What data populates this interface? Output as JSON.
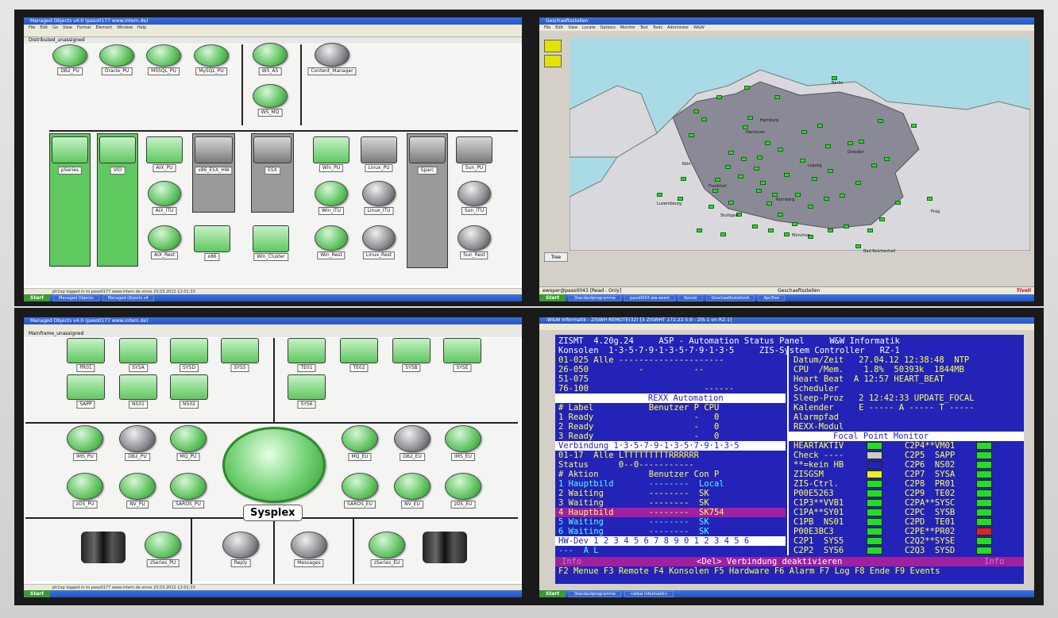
{
  "tl": {
    "title": "Managed Objects v4.0 (paso0177 www.intern.de)",
    "menu": [
      "File",
      "Edit",
      "Go",
      "View",
      "Format",
      "Element",
      "Window",
      "Help"
    ],
    "view_title": "Distributed_unassigned",
    "top_nodes": [
      "DB2_PU",
      "Oracle_PU",
      "MSSQL_PU",
      "MySQL_PU",
      "WS_AS",
      "WS_MQ",
      "Content_Manager"
    ],
    "mid_nodes": [
      "pSeries",
      "VIO",
      "AIX_PU",
      "AIX_ITU",
      "AIX_Rest",
      "x86_ESX_HW",
      "x86",
      "ESX",
      "Win_Cluster",
      "Win_PU",
      "Win_ITU",
      "Win_Rest",
      "Linux_PU",
      "Linux_ITU",
      "Linux_Rest",
      "Sparc",
      "Sun_PU",
      "Sun_ITU",
      "Sun_Rest"
    ],
    "statusline": "ph1op logged in to paso0177 www.intern.de since 23.03.2012 12:01:33",
    "start": "Start",
    "tasks": [
      "Managed Objects",
      "Managed Objects v4"
    ]
  },
  "tr": {
    "title": "Geschaeftsstellen",
    "menu": [
      "File",
      "Edit",
      "View",
      "Locate",
      "Options",
      "Monitor",
      "Test",
      "Tools",
      "Administer",
      "W&W"
    ],
    "tree_label": "Tree",
    "statusline": "ewoper@paso0043 [Read - Only]",
    "status_right": "Geschaeftsstellen",
    "brand": "Tivoli",
    "start": "Start",
    "tasks": [
      "Standardprogramme",
      "paso0043 ww-eexm",
      "Konsol",
      "GeschaeftsstellenA",
      "ApsTree"
    ],
    "cities": [
      "Hamburg",
      "Berlin",
      "Hannover",
      "Köln",
      "Frankfurt",
      "Stuttgart",
      "München",
      "Leipzig",
      "Dresden",
      "Nürnberg",
      "Prag",
      "Luxembourg",
      "Bad Reichenhall"
    ]
  },
  "bl": {
    "title": "Managed Objects v4.0 (paso0177 www.intern.de)",
    "view_title": "Mainframe_unassigned",
    "rects": [
      "PR01",
      "SYSA",
      "SYSD",
      "SYS5",
      "TE01",
      "TE02",
      "SYSB",
      "SYSE",
      "SAPP",
      "NS01",
      "NS02",
      "SYS6"
    ],
    "circles": [
      "IMS_PU",
      "DB2_PU",
      "MQ_PU",
      "MQ_EU",
      "DB2_EU",
      "IMS_EU",
      "zOS_PU",
      "NV_PU",
      "SAROS_PU",
      "SAROS_EU",
      "NV_EU",
      "zOS_EU",
      "zSeries_PU",
      "Reply",
      "Messages",
      "zSeries_EU"
    ],
    "center": "Sysplex",
    "statusline": "ph1op logged in to paso0177 www.intern.de since 23.03.2012 12:01:33",
    "start": "Start"
  },
  "br": {
    "title": "-W&W Informatik - ZISWH REMOTE(32) [3 ZISWHT 172.22.5.9 - ZIS-1 on RZ-1]",
    "lines": [
      "ZISMT  4.20g.24     ASP - Automation Status Panel     W&W Informatik",
      "Konsolen  1·3·5·7·9·1·3·5·7·9·1·3·5     ZIS-System Controller   RZ-1",
      "01-025 Alle ---------------------",
      "26-050          -          --",
      "51-075",
      "76-100                       ------",
      "         REXX Automation",
      "# Label           Benutzer P CPU",
      "1 Ready                    -   0",
      "2 Ready                    -   0",
      "3 Ready                    -   0",
      "Verbindung 1·3·5·7·9·1·3·5·7·9·1·3·5",
      "01-17  Alle LTTTTTTTTTRRRRRR",
      "Status      0--0-----------",
      "# Aktion          Benutzer Con P",
      "1 Hauptbild       --------  Local",
      "2 Waiting         --------  SK",
      "3 Waiting         --------  SK",
      "4 Hauptbild       --------  SK754",
      "5 Waiting         --------  SK",
      "6 Waiting         --------  SK",
      "HW-Dev 1 2 3 4 5 6 7 8 9 0 1 2 3 4 5 6",
      "---  A L"
    ],
    "right": [
      "Datum/Zeit   27.04.12 12:38:48  NTP",
      "CPU  /Mem.    1.8%  50393k  1844MB",
      "Heart Beat  A 12:57 HEART_BEAT",
      "Scheduler",
      "Sleep-Proz   2 12:42:33 UPDATE_FOCAL",
      "Kalender     E ----- A ----- T -----",
      "Alarmpfad",
      "REXX-Modul"
    ],
    "focal_title": "Focal Point Monitor",
    "focal_left": [
      "HEARTAKTIV",
      "Check ----",
      "**=kein HB",
      "ZISGSM",
      "ZIS-Ctrl.",
      "P00E5263",
      "C1P3**VVB1",
      "C1PA**SY01",
      "C1PB  NS01",
      "P00E3BC3",
      "C2P1  SYS5",
      "C2P2  SYS6"
    ],
    "focal_right": [
      "C2P4**VM01",
      "C2P5  SAPP",
      "C2P6  NS02",
      "C2P7  SYSA",
      "C2P8  PR01",
      "C2P9  TE02",
      "C2PA**SYSC",
      "C2PC  SYSB",
      "C2PD  TE01",
      "C2PE**PR02",
      "C2Q2**SYSE",
      "C2Q3  SYSD"
    ],
    "left_colors": [
      "#22dd22",
      "#cccccc",
      "#2323b8",
      "#eeee22",
      "#22dd22",
      "#22dd22",
      "#22dd22",
      "#22dd22",
      "#22dd22",
      "#22dd22",
      "#22dd22",
      "#22dd22"
    ],
    "right_colors": [
      "#22dd22",
      "#22dd22",
      "#22dd22",
      "#22dd22",
      "#22dd22",
      "#22dd22",
      "#22dd22",
      "#22dd22",
      "#22dd22",
      "#dd2222",
      "#22dd22",
      "#22dd22"
    ],
    "msg_info": "Info",
    "msg": "<Del> Verbindung deaktivieren",
    "msg_info2": "Info",
    "fkeys": "F2 Menue F3 Remote F4 Konsolen F5 Hardware F6 Alarm F7 Log F8 Ende F9 Events",
    "start": "Start",
    "tasks": [
      "Standardprogramme",
      "<w&w Informatik>"
    ]
  }
}
